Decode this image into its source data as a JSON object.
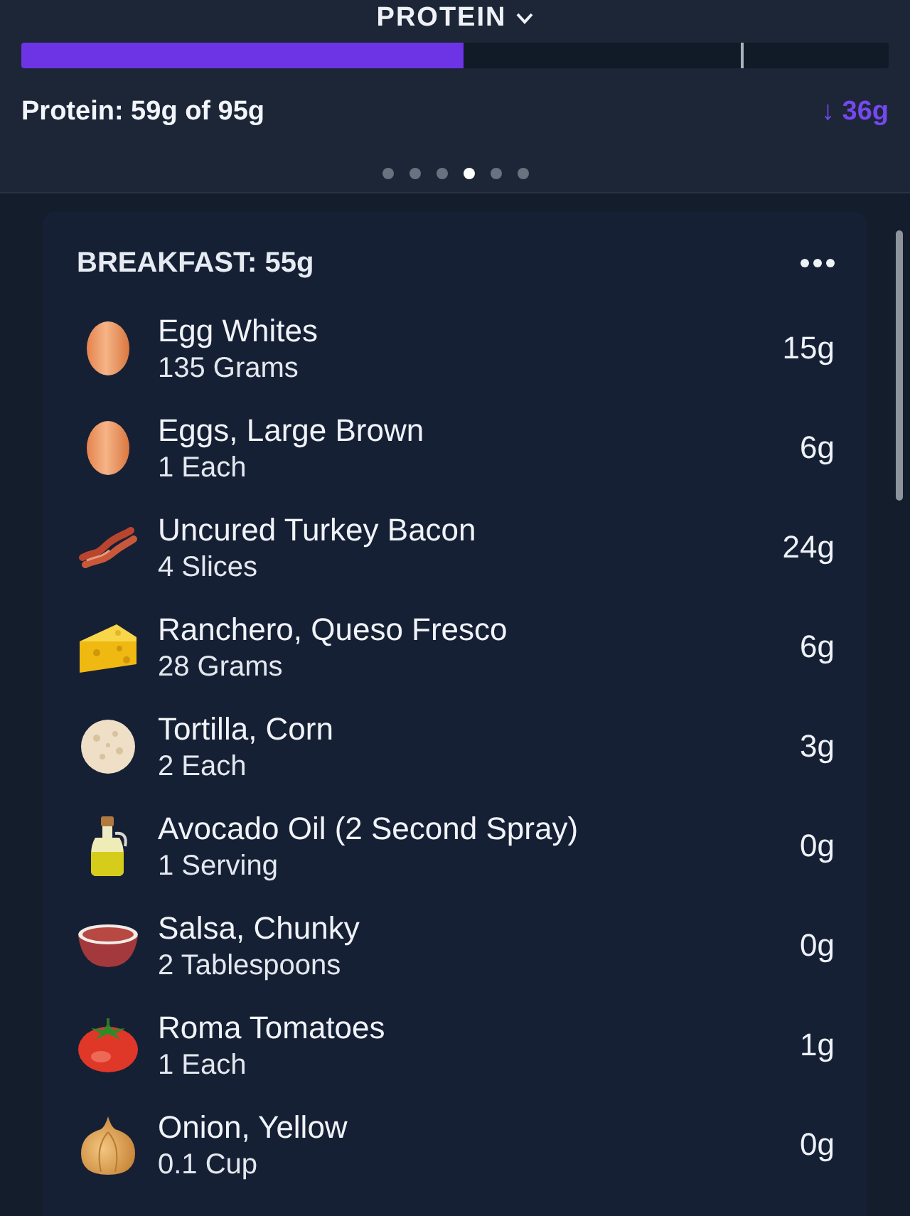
{
  "header": {
    "title": "PROTEIN"
  },
  "progress": {
    "level": 0.51,
    "marker": {
      "level": 0.83
    }
  },
  "summary": {
    "consumed": "Protein: 59g of 95g",
    "remaining": "↓ 36g"
  },
  "pager": {
    "dots": [
      {
        "selected": false
      },
      {
        "selected": false
      },
      {
        "selected": false
      },
      {
        "selected": true
      },
      {
        "selected": false
      },
      {
        "selected": false
      }
    ]
  },
  "meal": {
    "title": "BREAKFAST: 55g",
    "foods": [
      {
        "kind": "egg",
        "name": "Egg Whites",
        "serving": "135 Grams",
        "protein": "15g"
      },
      {
        "kind": "egg",
        "name": "Eggs, Large Brown",
        "serving": "1 Each",
        "protein": "6g"
      },
      {
        "kind": "bacon",
        "name": "Uncured Turkey Bacon",
        "serving": "4 Slices",
        "protein": "24g"
      },
      {
        "kind": "cheese",
        "name": "Ranchero, Queso Fresco",
        "serving": "28 Grams",
        "protein": "6g"
      },
      {
        "kind": "tortilla",
        "name": "Tortilla, Corn",
        "serving": "2 Each",
        "protein": "3g"
      },
      {
        "kind": "oil",
        "name": "Avocado Oil (2 Second Spray)",
        "serving": "1 Serving",
        "protein": "0g"
      },
      {
        "kind": "salsa",
        "name": "Salsa, Chunky",
        "serving": "2 Tablespoons",
        "protein": "0g"
      },
      {
        "kind": "tomato",
        "name": "Roma Tomatoes",
        "serving": "1 Each",
        "protein": "1g"
      },
      {
        "kind": "onion",
        "name": "Onion, Yellow",
        "serving": "0.1 Cup",
        "protein": "0g"
      }
    ]
  }
}
